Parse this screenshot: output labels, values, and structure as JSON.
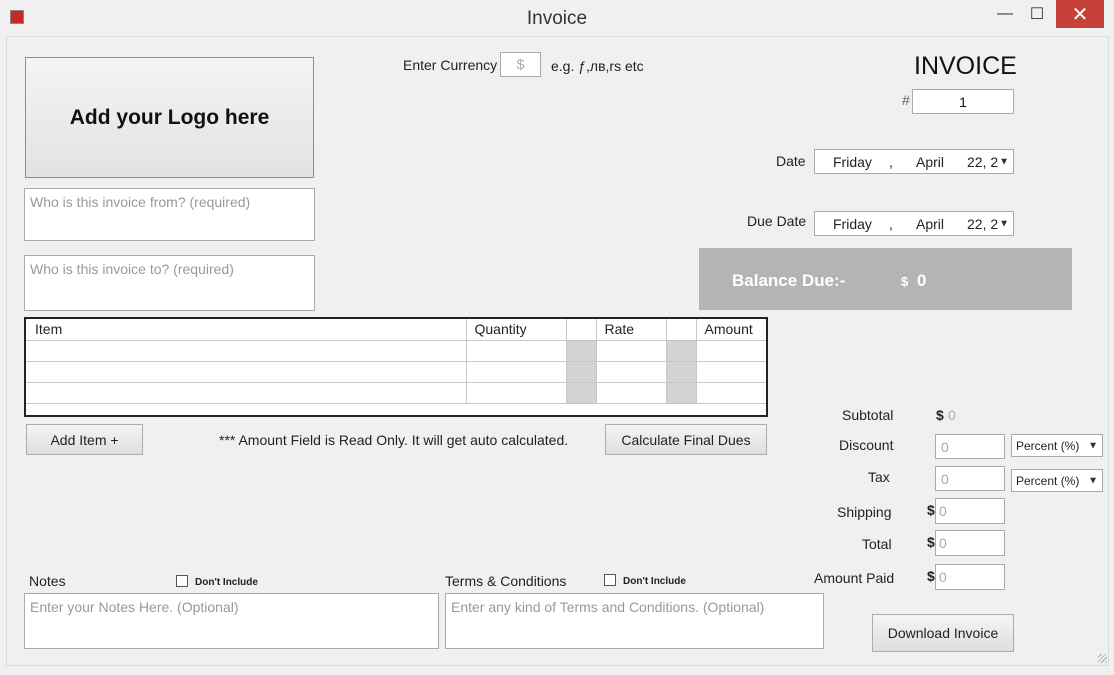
{
  "window": {
    "title": "Invoice",
    "minimize": "—",
    "maximize": "☐",
    "close": "✕"
  },
  "logo": {
    "label": "Add your Logo here"
  },
  "from": {
    "placeholder": "Who is this  invoice from? (required)"
  },
  "to": {
    "placeholder": "Who is this invoice to? (required)"
  },
  "currency": {
    "label": "Enter Currency",
    "value": "$",
    "hint": "e.g. ƒ,лв,rs etc"
  },
  "invoice": {
    "heading": "INVOICE",
    "hash": "#",
    "number": "1"
  },
  "date": {
    "label": "Date",
    "day": "Friday",
    "sep": ",",
    "month": "April",
    "rest": "22, 2"
  },
  "due_date": {
    "label": "Due Date",
    "day": "Friday",
    "sep": ",",
    "month": "April",
    "rest": "22, 2"
  },
  "balance": {
    "label": "Balance Due:-",
    "currency": "$",
    "value": "0"
  },
  "items_table": {
    "columns": [
      "Item",
      "Quantity",
      "",
      "Rate",
      "",
      "Amount"
    ],
    "rows": [
      [
        "",
        "",
        "",
        "",
        "",
        ""
      ],
      [
        "",
        "",
        "",
        "",
        "",
        ""
      ],
      [
        "",
        "",
        "",
        "",
        "",
        ""
      ]
    ]
  },
  "add_item": {
    "label": "Add Item +"
  },
  "read_only_note": "*** Amount Field is Read Only. It will get auto calculated.",
  "calc_button": {
    "label": "Calculate Final Dues"
  },
  "totals": {
    "subtotal": {
      "label": "Subtotal",
      "currency": "$",
      "value": "0"
    },
    "discount": {
      "label": "Discount",
      "value": "0",
      "type": "Percent (%)"
    },
    "tax": {
      "label": "Tax",
      "value": "0",
      "type": "Percent (%)"
    },
    "shipping": {
      "label": "Shipping",
      "currency": "$",
      "value": "0"
    },
    "total": {
      "label": "Total",
      "currency": "$",
      "value": "0"
    },
    "amount_paid": {
      "label": "Amount Paid",
      "currency": "$",
      "value": "0"
    }
  },
  "notes": {
    "label": "Notes",
    "dont_include": "Don't Include",
    "placeholder": "Enter your Notes Here. (Optional)"
  },
  "terms": {
    "label": "Terms & Conditions",
    "dont_include": "Don't Include",
    "placeholder": "Enter any kind of Terms and Conditions. (Optional)"
  },
  "download": {
    "label": "Download Invoice"
  },
  "colors": {
    "balance_bg": "#b4b4b4",
    "close_btn": "#c7403a",
    "logo_border": "#5b9bd5"
  }
}
